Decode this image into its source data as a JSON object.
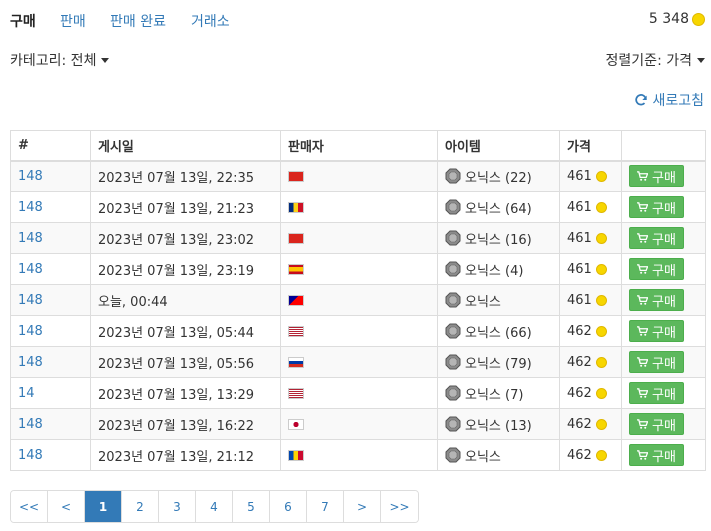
{
  "tabs": [
    {
      "label": "구매",
      "active": true
    },
    {
      "label": "판매",
      "active": false
    },
    {
      "label": "판매 완료",
      "active": false
    },
    {
      "label": "거래소",
      "active": false
    }
  ],
  "balance": {
    "amount": "5 348"
  },
  "filters": {
    "category": "카테고리: 전체",
    "sort": "정렬기준: 가격"
  },
  "refresh_label": "새로고침",
  "table": {
    "headers": [
      "#",
      "게시일",
      "판매자",
      "아이템",
      "가격",
      ""
    ],
    "buy_label": "구매",
    "rows": [
      {
        "id": "148",
        "date": "2023년 07월 13일, 22:35",
        "flag": "vn",
        "item": "오닉스 (22)",
        "price": "461"
      },
      {
        "id": "148",
        "date": "2023년 07월 13일, 21:23",
        "flag": "ro",
        "item": "오닉스 (64)",
        "price": "461"
      },
      {
        "id": "148",
        "date": "2023년 07월 13일, 23:02",
        "flag": "vn",
        "item": "오닉스 (16)",
        "price": "461"
      },
      {
        "id": "148",
        "date": "2023년 07월 13일, 23:19",
        "flag": "es",
        "item": "오닉스 (4)",
        "price": "461"
      },
      {
        "id": "148",
        "date": "오늘, 00:44",
        "flag": "tw",
        "item": "오닉스",
        "price": "461"
      },
      {
        "id": "148",
        "date": "2023년 07월 13일, 05:44",
        "flag": "us",
        "item": "오닉스 (66)",
        "price": "462"
      },
      {
        "id": "148",
        "date": "2023년 07월 13일, 05:56",
        "flag": "ru",
        "item": "오닉스 (79)",
        "price": "462"
      },
      {
        "id": "14",
        "date": "2023년 07월 13일, 13:29",
        "flag": "us",
        "item": "오닉스 (7)",
        "price": "462"
      },
      {
        "id": "148",
        "date": "2023년 07월 13일, 16:22",
        "flag": "jp",
        "item": "오닉스 (13)",
        "price": "462"
      },
      {
        "id": "148",
        "date": "2023년 07월 13일, 21:12",
        "flag": "md",
        "item": "오닉스",
        "price": "462"
      }
    ]
  },
  "pagination": [
    "<<",
    "<",
    "1",
    "2",
    "3",
    "4",
    "5",
    "6",
    "7",
    ">",
    ">>"
  ],
  "pagination_active": "1",
  "colors": {
    "link": "#337ab7",
    "buy_button": "#5cb85c",
    "coin": "#f7d600"
  }
}
